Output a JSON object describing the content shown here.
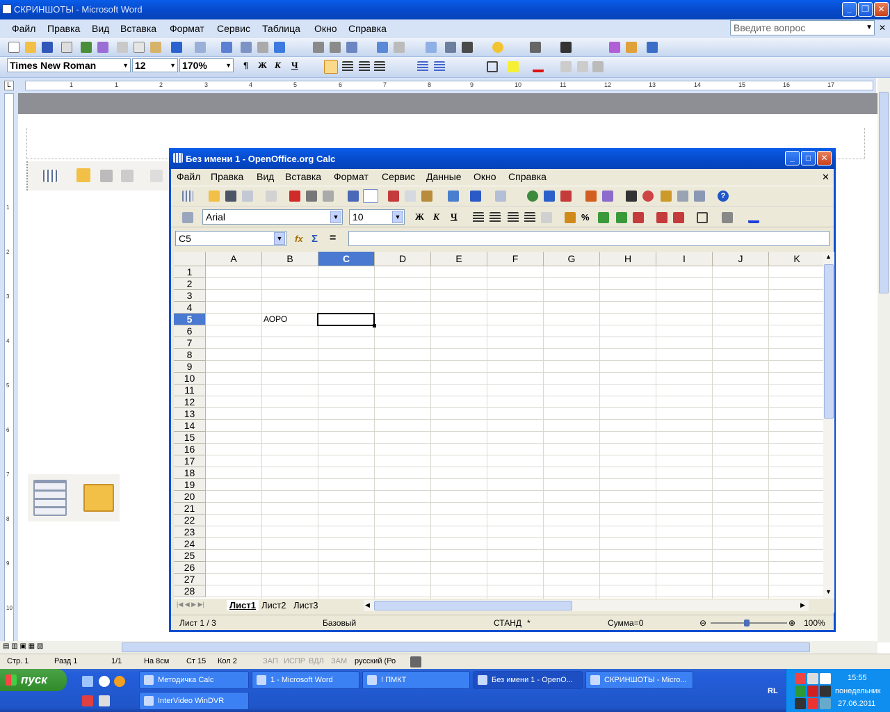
{
  "word": {
    "title": "СКРИНШОТЫ - Microsoft Word",
    "menu": [
      "Файл",
      "Правка",
      "Вид",
      "Вставка",
      "Формат",
      "Сервис",
      "Таблица",
      "Окно",
      "Справка"
    ],
    "ask_placeholder": "Введите вопрос",
    "font_name": "Times New Roman",
    "font_size": "12",
    "zoom": "170%",
    "fmt_buttons": [
      "¶",
      "Ж",
      "К",
      "Ч"
    ],
    "ruler_h": [
      "1",
      "1",
      "2",
      "3",
      "4",
      "5",
      "6",
      "7",
      "8",
      "9",
      "10",
      "11",
      "12",
      "13",
      "14",
      "15",
      "16",
      "17",
      "18"
    ],
    "ruler_v": [
      "1",
      "2",
      "3",
      "4",
      "5",
      "6",
      "7",
      "8",
      "9",
      "10"
    ],
    "status": {
      "page": "Стр. 1",
      "section": "Разд 1",
      "pages": "1/1",
      "at": "На 8см",
      "line": "Ст 15",
      "col": "Кол 2",
      "rec": "ЗАП",
      "trk": "ИСПР",
      "ext": "ВДЛ",
      "ovr": "ЗАМ",
      "lang": "русский (Ро"
    }
  },
  "calc": {
    "title": "Без имени 1 - OpenOffice.org Calc",
    "menu": [
      "Файл",
      "Правка",
      "Вид",
      "Вставка",
      "Формат",
      "Сервис",
      "Данные",
      "Окно",
      "Справка"
    ],
    "font_name": "Arial",
    "font_size": "10",
    "fmt_buttons": [
      "Ж",
      "К",
      "Ч"
    ],
    "cell_ref": "C5",
    "formula": "",
    "columns": [
      "A",
      "B",
      "C",
      "D",
      "E",
      "F",
      "G",
      "H",
      "I",
      "J",
      "K"
    ],
    "rows": [
      "1",
      "2",
      "3",
      "4",
      "5",
      "6",
      "7",
      "8",
      "9",
      "10",
      "11",
      "12",
      "13",
      "14",
      "15",
      "16",
      "17",
      "18",
      "19",
      "20",
      "21",
      "22",
      "23",
      "24",
      "25",
      "26",
      "27",
      "28"
    ],
    "cell_b5": "АОРО",
    "sheets": [
      "Лист1",
      "Лист2",
      "Лист3"
    ],
    "status": {
      "sheet": "Лист 1 / 3",
      "style": "Базовый",
      "mode": "СТАНД",
      "star": "*",
      "sum": "Сумма=0",
      "zoom": "100%"
    }
  },
  "taskbar": {
    "start": "пуск",
    "tasks": [
      "Методичка Calc",
      "1 - Microsoft Word",
      "! ПМКТ",
      "Без имени 1 - OpenO...",
      "СКРИНШОТЫ - Micro...",
      "InterVideo WinDVR"
    ],
    "lang": "RL",
    "time": "15:55",
    "day": "понедельник",
    "date": "27.06.2011"
  }
}
